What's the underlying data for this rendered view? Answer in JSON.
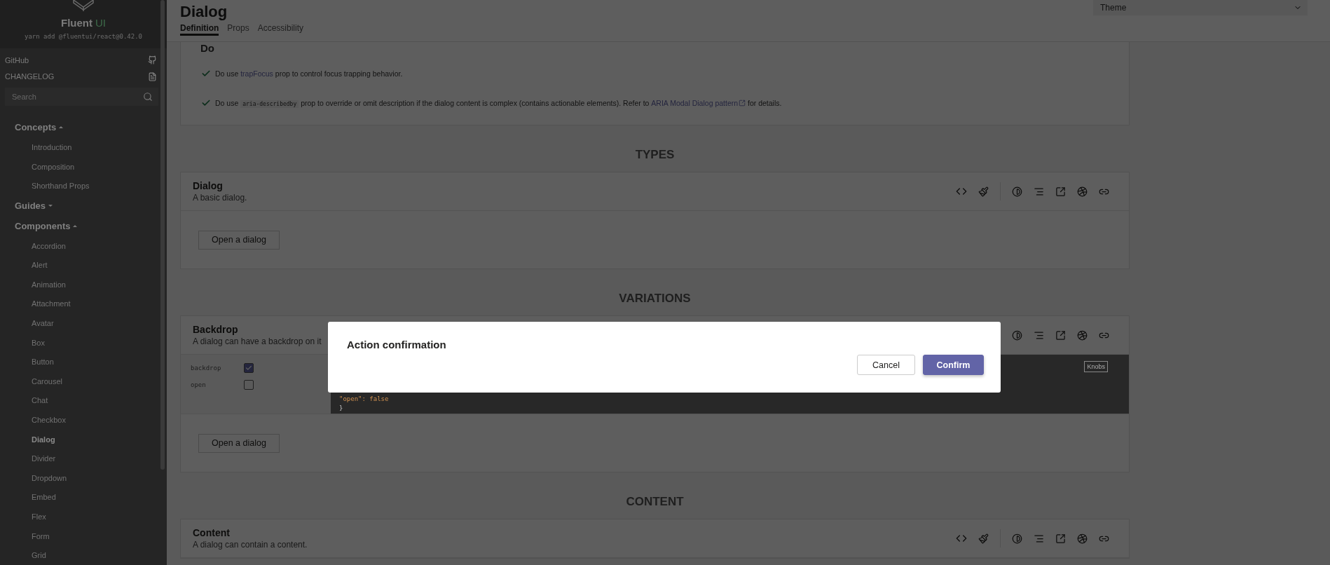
{
  "sidebar": {
    "logo_text": "Fluent",
    "logo_accent": "UI",
    "install_command": "yarn add @fluentui/react@0.42.0",
    "links": [
      {
        "label": "GitHub",
        "kind": "github"
      },
      {
        "label": "CHANGELOG",
        "kind": "changelog"
      }
    ],
    "search": {
      "placeholder": "Search"
    },
    "tree": [
      {
        "label": "Concepts",
        "expanded": true,
        "children": [
          {
            "label": "Introduction",
            "selected": false
          },
          {
            "label": "Composition",
            "selected": false
          },
          {
            "label": "Shorthand Props",
            "selected": false
          }
        ]
      },
      {
        "label": "Guides",
        "expanded": false
      },
      {
        "label": "Components",
        "expanded": true,
        "children": [
          {
            "label": "Accordion",
            "selected": false
          },
          {
            "label": "Alert",
            "selected": false
          },
          {
            "label": "Animation",
            "selected": false
          },
          {
            "label": "Attachment",
            "selected": false
          },
          {
            "label": "Avatar",
            "selected": false
          },
          {
            "label": "Box",
            "selected": false
          },
          {
            "label": "Button",
            "selected": false
          },
          {
            "label": "Carousel",
            "selected": false
          },
          {
            "label": "Chat",
            "selected": false
          },
          {
            "label": "Checkbox",
            "selected": false
          },
          {
            "label": "Dialog",
            "selected": true
          },
          {
            "label": "Divider",
            "selected": false
          },
          {
            "label": "Dropdown",
            "selected": false
          },
          {
            "label": "Embed",
            "selected": false
          },
          {
            "label": "Flex",
            "selected": false
          },
          {
            "label": "Form",
            "selected": false
          },
          {
            "label": "Grid",
            "selected": false
          }
        ]
      }
    ]
  },
  "header": {
    "title": "Dialog",
    "tabs": [
      {
        "label": "Definition",
        "selected": true
      },
      {
        "label": "Props",
        "selected": false
      },
      {
        "label": "Accessibility",
        "selected": false
      }
    ],
    "theme_dropdown": {
      "placeholder": "Theme"
    }
  },
  "do_section": {
    "heading": "Do",
    "items": [
      {
        "parts": [
          {
            "kind": "text",
            "text": "Do use "
          },
          {
            "kind": "link",
            "text": "trapFocus"
          },
          {
            "kind": "text",
            "text": " prop to control focus trapping behavior."
          }
        ]
      },
      {
        "parts": [
          {
            "kind": "text",
            "text": "Do use "
          },
          {
            "kind": "code",
            "text": "aria-describedby"
          },
          {
            "kind": "text",
            "text": " prop to override or omit description if the dialog content is complex (contains actionable elements). Refer to "
          },
          {
            "kind": "external_link",
            "text": "ARIA Modal Dialog pattern"
          },
          {
            "kind": "text",
            "text": " for details."
          }
        ]
      }
    ]
  },
  "sections": [
    {
      "heading": "TYPES",
      "examples": [
        {
          "title": "Dialog",
          "description": "A basic dialog.",
          "button": "Open a dialog"
        }
      ]
    },
    {
      "heading": "VARIATIONS",
      "examples": [
        {
          "title": "Backdrop",
          "description": "A dialog can have a backdrop on it",
          "knobs": [
            {
              "label": "backdrop",
              "checked": true
            },
            {
              "label": "open",
              "checked": false
            }
          ],
          "knobs_label": "Knobs",
          "code_lines": [
            "\"open\": false",
            "}"
          ],
          "button": "Open a dialog"
        }
      ]
    },
    {
      "heading": "CONTENT",
      "examples": [
        {
          "title": "Content",
          "description": "A dialog can contain a content."
        }
      ]
    }
  ],
  "dialog": {
    "title": "Action confirmation",
    "buttons": [
      {
        "label": "Cancel",
        "kind": "secondary"
      },
      {
        "label": "Confirm",
        "kind": "primary"
      }
    ]
  }
}
